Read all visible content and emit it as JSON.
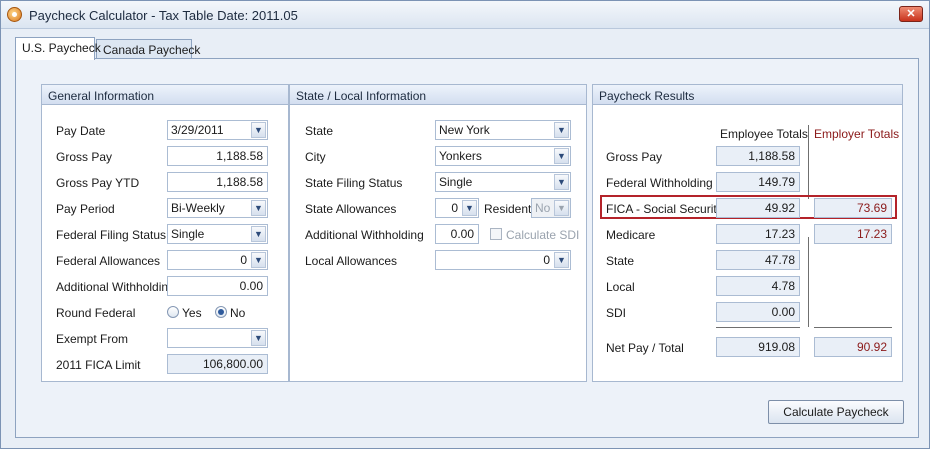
{
  "window": {
    "title": "Paycheck Calculator - Tax Table Date: 2011.05",
    "close_label": "✕"
  },
  "tabs": [
    {
      "label": "U.S. Paycheck",
      "active": true
    },
    {
      "label": "Canada Paycheck",
      "active": false
    }
  ],
  "general": {
    "header": "General Information",
    "pay_date": {
      "label": "Pay Date",
      "value": "3/29/2011"
    },
    "gross_pay": {
      "label": "Gross Pay",
      "value": "1,188.58"
    },
    "gross_pay_ytd": {
      "label": "Gross Pay YTD",
      "value": "1,188.58"
    },
    "pay_period": {
      "label": "Pay Period",
      "value": "Bi-Weekly"
    },
    "federal_filing_status": {
      "label": "Federal Filing Status",
      "value": "Single"
    },
    "federal_allowances": {
      "label": "Federal Allowances",
      "value": "0"
    },
    "additional_withholding": {
      "label": "Additional Withholding",
      "value": "0.00"
    },
    "round_federal": {
      "label": "Round Federal",
      "yes_label": "Yes",
      "no_label": "No",
      "selected": "No"
    },
    "exempt_from": {
      "label": "Exempt From",
      "value": ""
    },
    "fica_limit": {
      "label": "2011 FICA Limit",
      "value": "106,800.00"
    }
  },
  "state": {
    "header": "State / Local Information",
    "state": {
      "label": "State",
      "value": "New York"
    },
    "city": {
      "label": "City",
      "value": "Yonkers"
    },
    "state_filing_status": {
      "label": "State Filing Status",
      "value": "Single"
    },
    "state_allowances": {
      "label": "State Allowances",
      "value": "0"
    },
    "resident": {
      "label": "Resident",
      "value": "No"
    },
    "additional_withholding": {
      "label": "Additional Withholding",
      "value": "0.00"
    },
    "calculate_sdi": {
      "label": "Calculate SDI",
      "checked": false
    },
    "local_allowances": {
      "label": "Local Allowances",
      "value": "0"
    }
  },
  "results": {
    "header": "Paycheck Results",
    "employee_header": "Employee Totals",
    "employer_header": "Employer Totals",
    "rows": [
      {
        "label": "Gross Pay",
        "employee": "1,188.58",
        "employer": null
      },
      {
        "label": "Federal Withholding",
        "employee": "149.79",
        "employer": null
      },
      {
        "label": "FICA - Social Security",
        "employee": "49.92",
        "employer": "73.69"
      },
      {
        "label": "Medicare",
        "employee": "17.23",
        "employer": "17.23"
      },
      {
        "label": "State",
        "employee": "47.78",
        "employer": null
      },
      {
        "label": "Local",
        "employee": "4.78",
        "employer": null
      },
      {
        "label": "SDI",
        "employee": "0.00",
        "employer": null
      }
    ],
    "net_pay": {
      "label": "Net Pay  /  Total",
      "employee": "919.08",
      "employer": "90.92"
    }
  },
  "actions": {
    "calculate_label": "Calculate Paycheck"
  },
  "colors": {
    "employer_text": "#8b1a1a",
    "highlight": "#b4232a"
  }
}
